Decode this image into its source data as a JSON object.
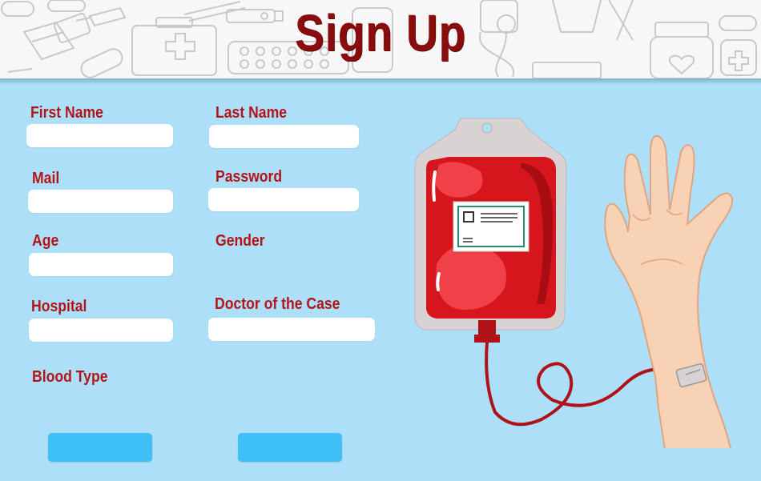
{
  "page": {
    "title": "Sign Up"
  },
  "form": {
    "first_name": {
      "label": "First Name",
      "value": "",
      "placeholder": ""
    },
    "last_name": {
      "label": "Last Name",
      "value": "",
      "placeholder": ""
    },
    "mail": {
      "label": "Mail",
      "value": "",
      "placeholder": ""
    },
    "password": {
      "label": "Password",
      "value": "",
      "placeholder": ""
    },
    "age": {
      "label": "Age",
      "value": "",
      "placeholder": ""
    },
    "gender": {
      "label": "Gender"
    },
    "hospital": {
      "label": "Hospital",
      "value": "",
      "placeholder": ""
    },
    "doctor": {
      "label": "Doctor of the Case",
      "value": "",
      "placeholder": ""
    },
    "blood_type": {
      "label": "Blood Type"
    }
  },
  "buttons": {
    "primary_label": "",
    "secondary_label": ""
  },
  "colors": {
    "background": "#ade0f8",
    "title": "#8b0c0c",
    "label": "#b3151a",
    "button": "#3ec0f7",
    "blood": "#d7151c"
  }
}
